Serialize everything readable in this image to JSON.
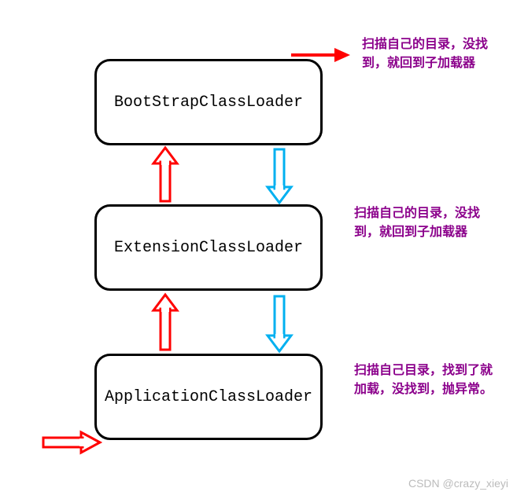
{
  "boxes": {
    "top": "BootStrapClassLoader",
    "middle": "ExtensionClassLoader",
    "bottom": "ApplicationClassLoader"
  },
  "annotations": {
    "top": "扫描自己的目录，没找到，就回到子加载器",
    "middle": "扫描自己的目录，没找到，就回到子加载器",
    "bottom": "扫描自己目录，找到了就加载，没找到，抛异常。"
  },
  "watermark": "CSDN @crazy_xieyi",
  "colors": {
    "red": "#ff0000",
    "blue": "#00b0f0",
    "purple": "#8b008b"
  }
}
